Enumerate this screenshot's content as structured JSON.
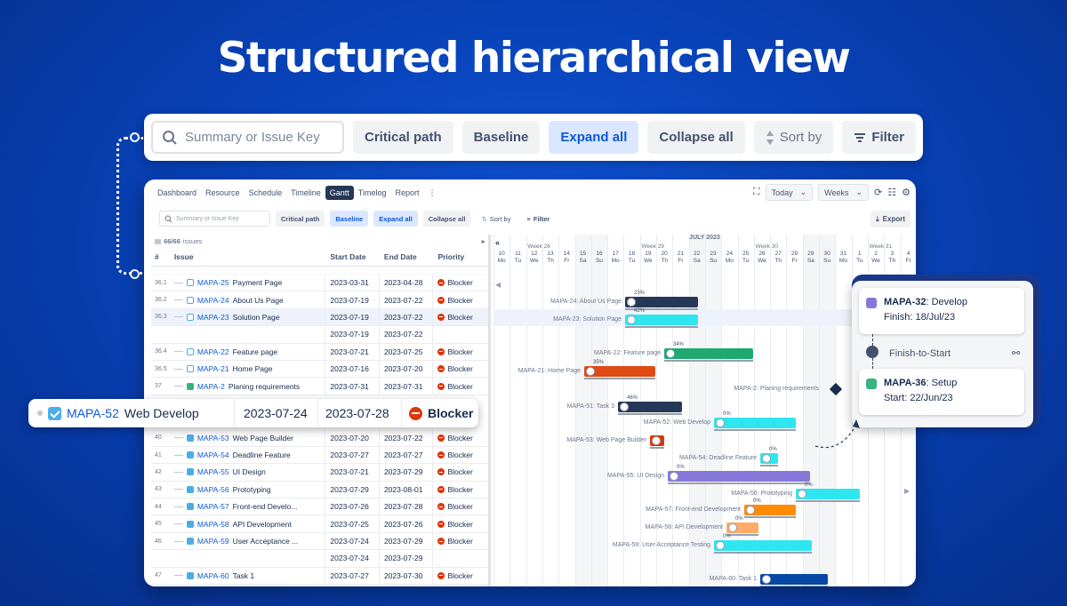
{
  "hero_title": "Structured hierarchical view",
  "big_toolbar": {
    "search_placeholder": "Summary or Issue Key",
    "critical_path": "Critical path",
    "baseline": "Baseline",
    "expand_all": "Expand all",
    "collapse_all": "Collapse all",
    "sort_by": "Sort by",
    "filter": "Filter"
  },
  "nav": {
    "tabs": [
      "Dashboard",
      "Resource",
      "Schedule",
      "Timeline",
      "Gantt",
      "Timelog",
      "Report"
    ],
    "active": "Gantt",
    "today": "Today",
    "weeks": "Weeks"
  },
  "small_toolbar": {
    "search_placeholder": "Summary or Issue Key",
    "critical_path": "Critical path",
    "baseline": "Baseline",
    "expand_all": "Expand all",
    "collapse_all": "Collapse all",
    "sort_by": "Sort by",
    "filter": "Filter",
    "export": "Export"
  },
  "table": {
    "count": "66/66",
    "count_label": "issues",
    "headers": {
      "num": "#",
      "issue": "Issue",
      "start": "Start Date",
      "end": "End Date",
      "priority": "Priority"
    },
    "rows": [
      {
        "num": "36.1",
        "key": "MAPA-25",
        "title": "Payment Page",
        "start": "2023-03-31",
        "end": "2023-04-28",
        "priority": "Blocker",
        "icon": "subtask"
      },
      {
        "num": "36.2",
        "key": "MAPA-24",
        "title": "About Us Page",
        "start": "2023-07-19",
        "end": "2023-07-22",
        "priority": "Blocker",
        "icon": "subtask"
      },
      {
        "num": "36.3",
        "key": "MAPA-23",
        "title": "Solution Page",
        "start": "2023-07-19",
        "end": "2023-07-22",
        "priority": "Blocker",
        "icon": "subtask"
      },
      {
        "num": "",
        "key": "",
        "title": "",
        "start": "2023-07-19",
        "end": "2023-07-22",
        "priority": "",
        "icon": ""
      },
      {
        "num": "36.4",
        "key": "MAPA-22",
        "title": "Feature page",
        "start": "2023-07-21",
        "end": "2023-07-25",
        "priority": "Blocker",
        "icon": "subtask"
      },
      {
        "num": "36.5",
        "key": "MAPA-21",
        "title": "Home Page",
        "start": "2023-07-16",
        "end": "2023-07-20",
        "priority": "Blocker",
        "icon": "subtask"
      },
      {
        "num": "37",
        "key": "MAPA-2",
        "title": "Planing requirements",
        "start": "2023-07-31",
        "end": "2023-07-31",
        "priority": "Blocker",
        "icon": "story"
      },
      {
        "num": "",
        "key": "",
        "title": "",
        "start": "",
        "end": "",
        "priority": "",
        "icon": ""
      },
      {
        "num": "",
        "key": "",
        "title": "",
        "start": "",
        "end": "",
        "priority": "",
        "icon": ""
      },
      {
        "num": "40",
        "key": "MAPA-53",
        "title": "Web Page Builder",
        "start": "2023-07-20",
        "end": "2023-07-22",
        "priority": "Blocker",
        "icon": "task"
      },
      {
        "num": "41",
        "key": "MAPA-54",
        "title": "Deadline Feature",
        "start": "2023-07-27",
        "end": "2023-07-27",
        "priority": "Blocker",
        "icon": "task"
      },
      {
        "num": "42",
        "key": "MAPA-55",
        "title": "UI Design",
        "start": "2023-07-21",
        "end": "2023-07-29",
        "priority": "Blocker",
        "icon": "task"
      },
      {
        "num": "43",
        "key": "MAPA-56",
        "title": "Prototyping",
        "start": "2023-07-29",
        "end": "2023-08-01",
        "priority": "Blocker",
        "icon": "task"
      },
      {
        "num": "44",
        "key": "MAPA-57",
        "title": "Front-end Develo...",
        "start": "2023-07-26",
        "end": "2023-07-28",
        "priority": "Blocker",
        "icon": "task"
      },
      {
        "num": "45",
        "key": "MAPA-58",
        "title": "API Development",
        "start": "2023-07-25",
        "end": "2023-07-26",
        "priority": "Blocker",
        "icon": "task"
      },
      {
        "num": "46",
        "key": "MAPA-59",
        "title": "User Acceptance ...",
        "start": "2023-07-24",
        "end": "2023-07-29",
        "priority": "Blocker",
        "icon": "task"
      },
      {
        "num": "",
        "key": "",
        "title": "",
        "start": "2023-07-24",
        "end": "2023-07-29",
        "priority": "",
        "icon": ""
      },
      {
        "num": "47",
        "key": "MAPA-60",
        "title": "Task 1",
        "start": "2023-07-27",
        "end": "2023-07-30",
        "priority": "Blocker",
        "icon": "task"
      }
    ]
  },
  "highlight_row": {
    "key": "MAPA-52",
    "title": "Web Develop",
    "start": "2023-07-24",
    "end": "2023-07-28",
    "priority": "Blocker"
  },
  "gantt": {
    "month": "JULY 2023",
    "weeks": [
      "Week 28",
      "Week 29",
      "Week 30",
      "Week 31"
    ],
    "days": [
      {
        "n": "10",
        "d": "Mo"
      },
      {
        "n": "11",
        "d": "Tu"
      },
      {
        "n": "12",
        "d": "We"
      },
      {
        "n": "13",
        "d": "Th"
      },
      {
        "n": "14",
        "d": "Fr"
      },
      {
        "n": "15",
        "d": "Sa"
      },
      {
        "n": "16",
        "d": "Su"
      },
      {
        "n": "17",
        "d": "Mo"
      },
      {
        "n": "18",
        "d": "Tu"
      },
      {
        "n": "19",
        "d": "We"
      },
      {
        "n": "20",
        "d": "Th"
      },
      {
        "n": "21",
        "d": "Fr"
      },
      {
        "n": "22",
        "d": "Sa"
      },
      {
        "n": "23",
        "d": "Su"
      },
      {
        "n": "24",
        "d": "Mo"
      },
      {
        "n": "25",
        "d": "Tu"
      },
      {
        "n": "26",
        "d": "We"
      },
      {
        "n": "27",
        "d": "Th"
      },
      {
        "n": "28",
        "d": "Fr"
      },
      {
        "n": "29",
        "d": "Sa"
      },
      {
        "n": "30",
        "d": "Su"
      },
      {
        "n": "31",
        "d": "Mo"
      },
      {
        "n": "1",
        "d": "Tu"
      },
      {
        "n": "2",
        "d": "We"
      },
      {
        "n": "3",
        "d": "Th"
      },
      {
        "n": "4",
        "d": "Fr"
      }
    ],
    "bars": [
      {
        "label": "MAPA-24: About Us Page",
        "pct": "23%",
        "color": "#253858"
      },
      {
        "label": "MAPA-23: Solution Page",
        "pct": "42%",
        "color": "#2ee6f0"
      },
      {
        "label": "MAPA-22: Feature page",
        "pct": "34%",
        "color": "#1fa971"
      },
      {
        "label": "MAPA-21: Home Page",
        "pct": "35%",
        "color": "#e04a13"
      },
      {
        "label": "MAPA-2: Planing requirements",
        "pct": "",
        "color": "#253858"
      },
      {
        "label": "MAPA-51: Task 3",
        "pct": "46%",
        "color": "#253858"
      },
      {
        "label": "MAPA-52: Web Develop",
        "pct": "0%",
        "color": "#2ee6f0"
      },
      {
        "label": "MAPA-53: Web Page Builder",
        "pct": "",
        "color": "#de350b"
      },
      {
        "label": "MAPA-54: Deadline Feature",
        "pct": "0%",
        "color": "#2ee6f0"
      },
      {
        "label": "MAPA-55: UI Design",
        "pct": "0%",
        "color": "#8777d9"
      },
      {
        "label": "MAPA-56: Prototyping",
        "pct": "0%",
        "color": "#2ee6f0"
      },
      {
        "label": "MAPA-57: Front-end Development",
        "pct": "0%",
        "color": "#ff8b00"
      },
      {
        "label": "MAPA-58: API Development",
        "pct": "0%",
        "color": "#ffab66"
      },
      {
        "label": "MAPA-59: User Acceptance Testing",
        "pct": "0%",
        "color": "#2ee6f0"
      },
      {
        "label": "MAPA-60: Task 1",
        "pct": "",
        "color": "#0747a6"
      }
    ]
  },
  "dependency": {
    "from_key": "MAPA-32",
    "from_title": "Develop",
    "from_sub": "Finish: 18/Jul/23",
    "type": "Finish-to-Start",
    "to_key": "MAPA-36",
    "to_title": "Setup",
    "to_sub": "Start: 22/Jun/23"
  },
  "colors": {
    "bg": "#0a46c0",
    "accent": "#0c5ad4",
    "blocker": "#de350b"
  }
}
